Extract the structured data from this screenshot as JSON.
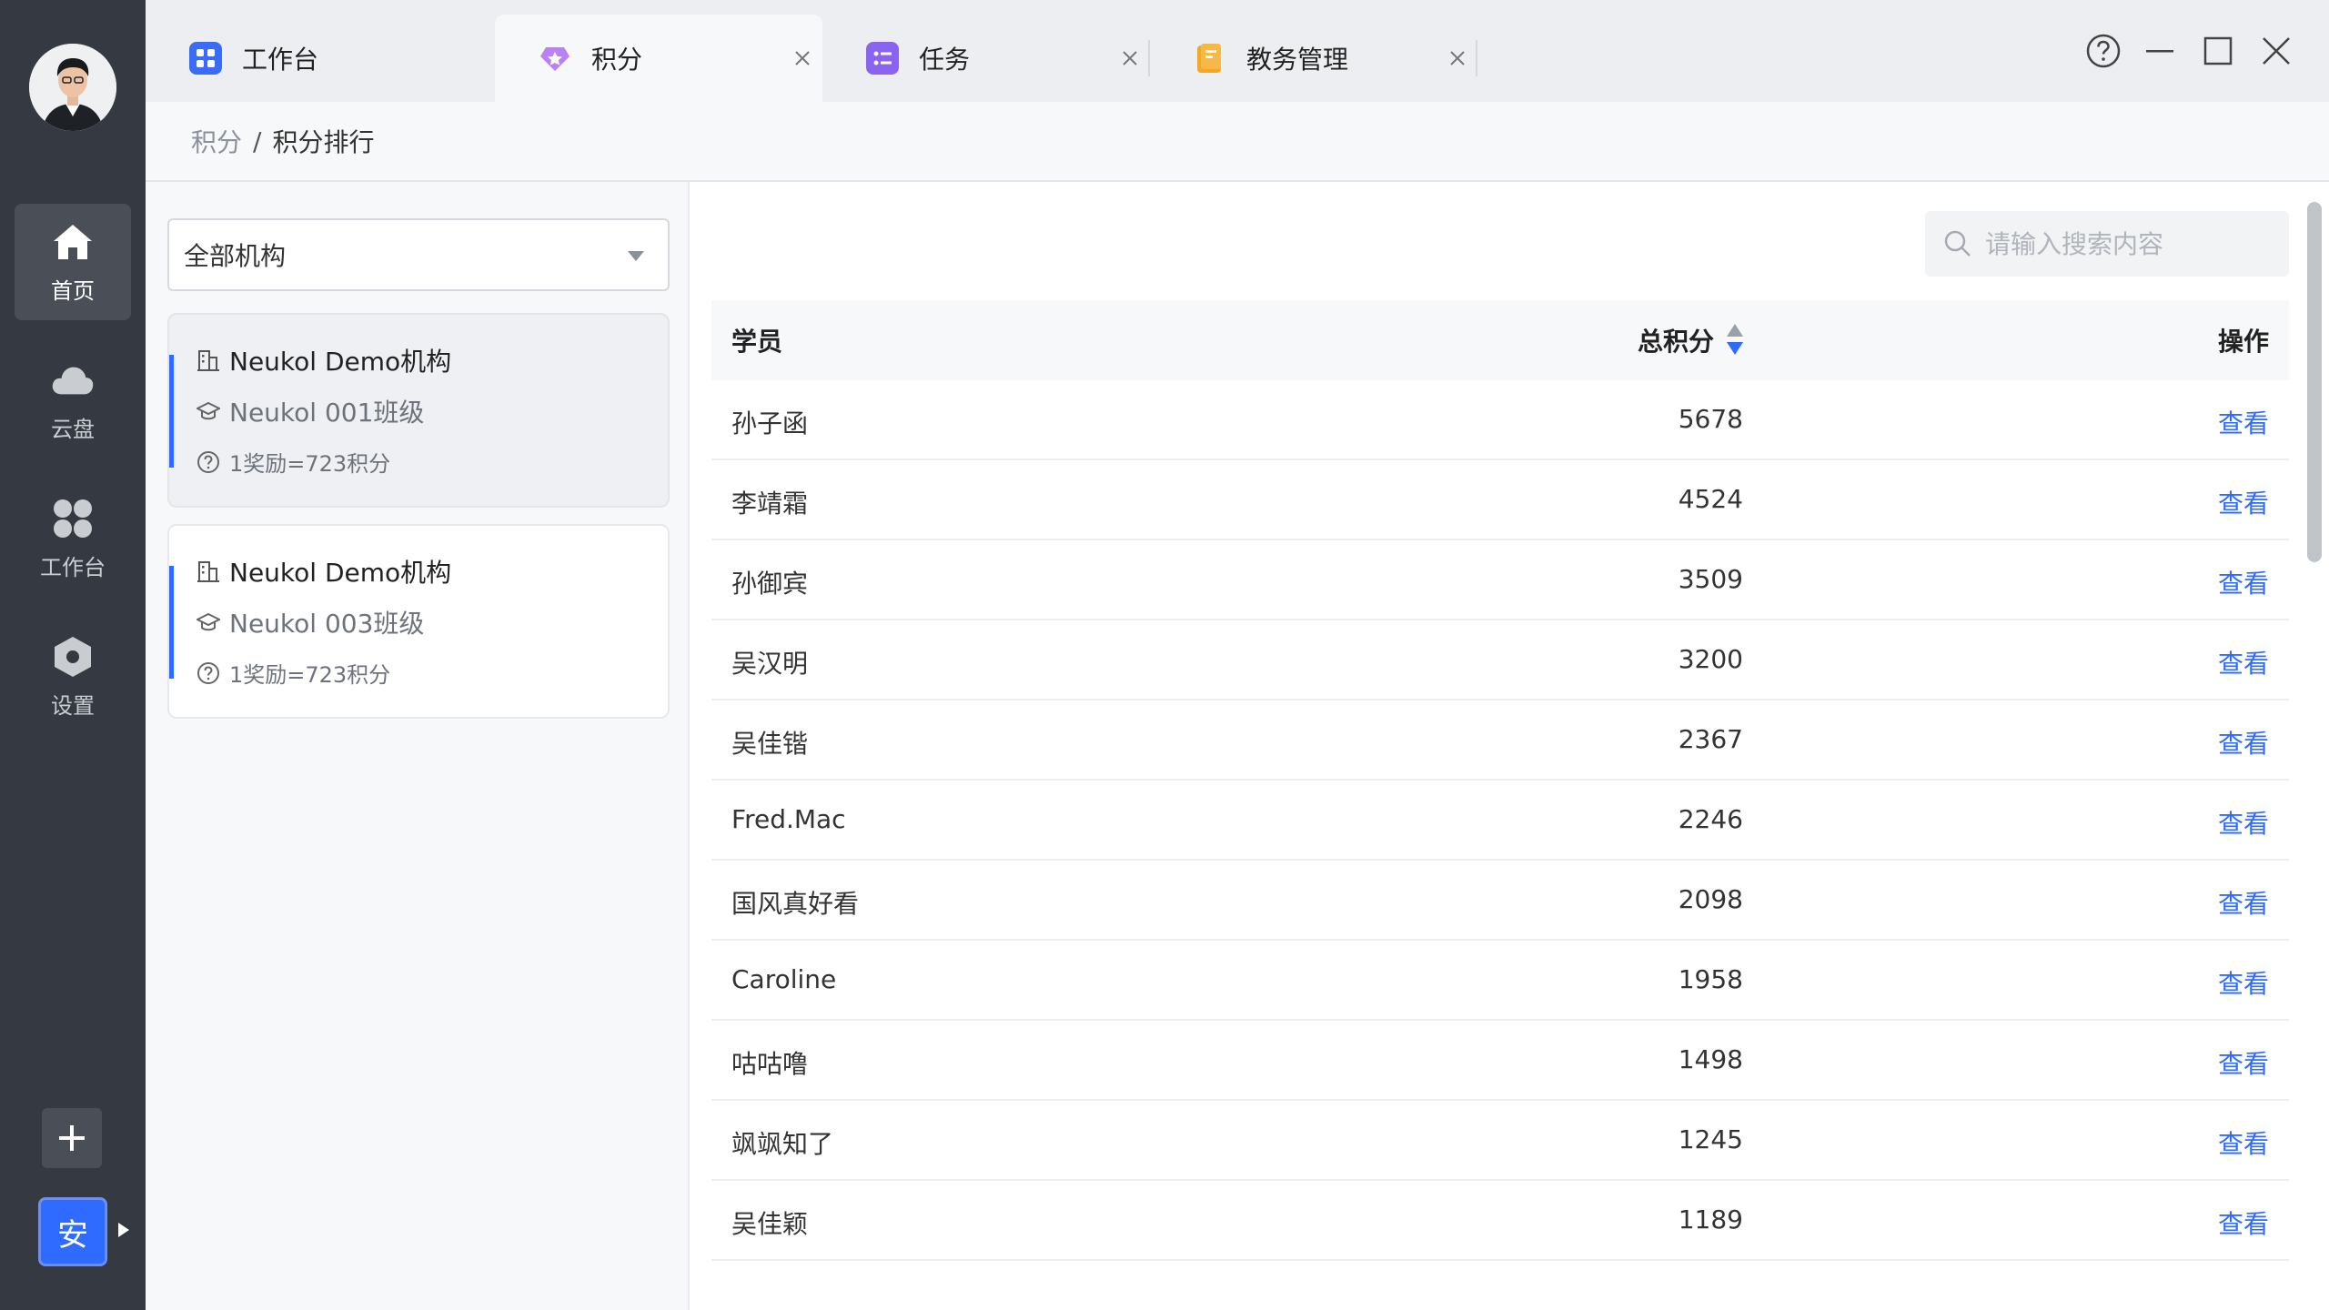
{
  "tabs": [
    {
      "label": "工作台",
      "closable": false
    },
    {
      "label": "积分",
      "closable": true
    },
    {
      "label": "任务",
      "closable": true
    },
    {
      "label": "教务管理",
      "closable": true
    }
  ],
  "sidebar": {
    "items": [
      {
        "label": "首页",
        "icon": "home-icon"
      },
      {
        "label": "云盘",
        "icon": "cloud-icon"
      },
      {
        "label": "工作台",
        "icon": "apps-icon"
      },
      {
        "label": "设置",
        "icon": "settings-icon"
      }
    ],
    "user_badge": "安"
  },
  "breadcrumb": {
    "parent": "积分",
    "separator": "/",
    "current": "积分排行"
  },
  "filter": {
    "org_select": "全部机构"
  },
  "cards": [
    {
      "org": "Neukol Demo机构",
      "class_name": "Neukol 001班级",
      "rule": "1奖励=723积分"
    },
    {
      "org": "Neukol Demo机构",
      "class_name": "Neukol 003班级",
      "rule": "1奖励=723积分"
    }
  ],
  "search": {
    "placeholder": "请输入搜索内容"
  },
  "table": {
    "headers": {
      "student": "学员",
      "score": "总积分",
      "action": "操作"
    },
    "rows": [
      {
        "name": "孙子函",
        "score": "5678",
        "action": "查看"
      },
      {
        "name": "李靖霜",
        "score": "4524",
        "action": "查看"
      },
      {
        "name": "孙御宾",
        "score": "3509",
        "action": "查看"
      },
      {
        "name": "吴汉明",
        "score": "3200",
        "action": "查看"
      },
      {
        "name": "吴佳锴",
        "score": "2367",
        "action": "查看"
      },
      {
        "name": "Fred.Mac",
        "score": "2246",
        "action": "查看"
      },
      {
        "name": "国风真好看",
        "score": "2098",
        "action": "查看"
      },
      {
        "name": "Caroline",
        "score": "1958",
        "action": "查看"
      },
      {
        "name": "咕咕噜",
        "score": "1498",
        "action": "查看"
      },
      {
        "name": "飒飒知了",
        "score": "1245",
        "action": "查看"
      },
      {
        "name": "吴佳颖",
        "score": "1189",
        "action": "查看"
      }
    ]
  },
  "colors": {
    "accent": "#2f6bff",
    "rail": "#353a42",
    "tab_bar": "#eceef1"
  }
}
